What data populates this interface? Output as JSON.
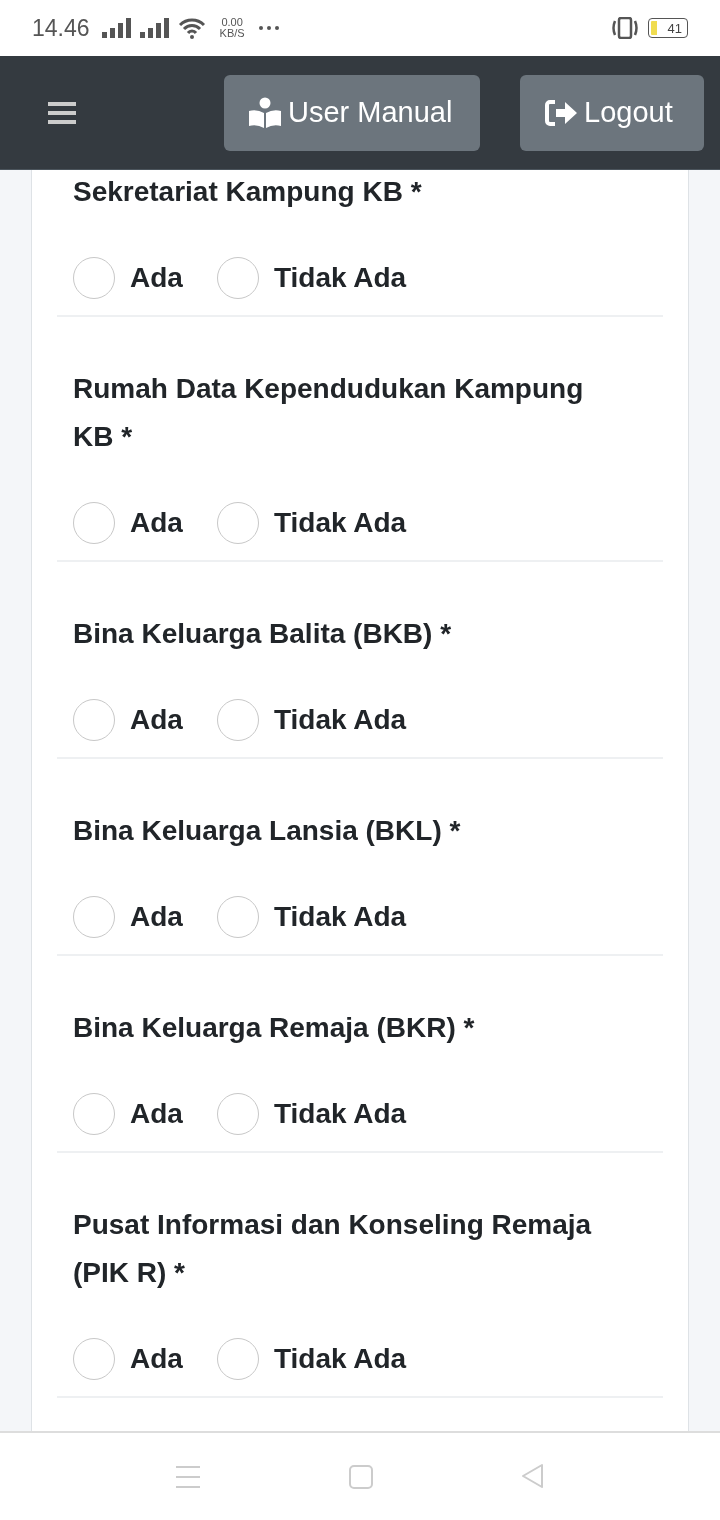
{
  "status_bar": {
    "time": "14.46",
    "net_speed": "0.00",
    "net_unit": "KB/S",
    "battery": "41"
  },
  "header": {
    "buttons": [
      {
        "kind": "manual",
        "label": "User Manual"
      },
      {
        "kind": "logout",
        "label": "Logout"
      }
    ]
  },
  "questions": [
    {
      "title": "Sekretariat Kampung KB *",
      "options": [
        {
          "label": "Ada",
          "selected": false
        },
        {
          "label": "Tidak Ada",
          "selected": false
        }
      ]
    },
    {
      "title": "Rumah Data Kependudukan Kampung KB *",
      "options": [
        {
          "label": "Ada",
          "selected": false
        },
        {
          "label": "Tidak Ada",
          "selected": false
        }
      ]
    },
    {
      "title": "Bina Keluarga Balita (BKB) *",
      "options": [
        {
          "label": "Ada",
          "selected": false
        },
        {
          "label": "Tidak Ada",
          "selected": false
        }
      ]
    },
    {
      "title": "Bina Keluarga Lansia (BKL) *",
      "options": [
        {
          "label": "Ada",
          "selected": false
        },
        {
          "label": "Tidak Ada",
          "selected": false
        }
      ]
    },
    {
      "title": "Bina Keluarga Remaja (BKR) *",
      "options": [
        {
          "label": "Ada",
          "selected": false
        },
        {
          "label": "Tidak Ada",
          "selected": false
        }
      ]
    },
    {
      "title": "Pusat Informasi dan Konseling Remaja (PIK R) *",
      "options": [
        {
          "label": "Ada",
          "selected": false
        },
        {
          "label": "Tidak Ada",
          "selected": false
        }
      ]
    }
  ]
}
